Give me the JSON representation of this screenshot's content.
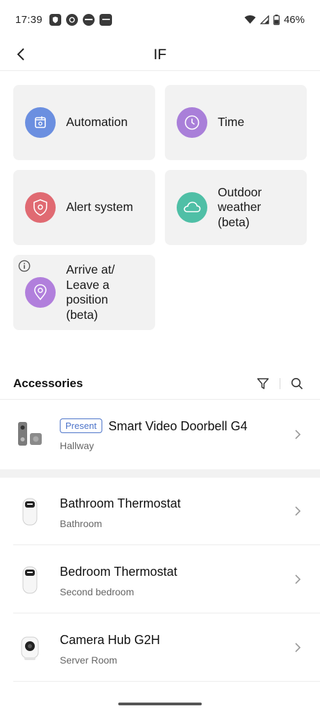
{
  "status_bar": {
    "time": "17:39",
    "notification_icons": [
      "shield-icon",
      "ring-icon",
      "yale-icon",
      "aqara-icon"
    ],
    "battery": "46%"
  },
  "header": {
    "title": "IF"
  },
  "tiles": [
    {
      "label": "Automation",
      "icon": "automation-icon",
      "color": "#6b8fe0"
    },
    {
      "label": "Time",
      "icon": "clock-icon",
      "color": "#a97fd9"
    },
    {
      "label": "Alert system",
      "icon": "shield-icon",
      "color": "#e06a72"
    },
    {
      "label": "Outdoor\nweather\n(beta)",
      "icon": "cloud-icon",
      "color": "#4fbfa6"
    },
    {
      "label": "Arrive at/\nLeave a\nposition\n(beta)",
      "icon": "location-pin-icon",
      "color": "#b17fdc"
    }
  ],
  "accessories": {
    "title": "Accessories",
    "items": [
      {
        "name": "Smart Video Doorbell G4",
        "room": "Hallway",
        "badge": "Present"
      },
      {
        "name": "Bathroom Thermostat",
        "room": "Bathroom"
      },
      {
        "name": "Bedroom Thermostat",
        "room": "Second bedroom"
      },
      {
        "name": "Camera Hub G2H",
        "room": "Server Room"
      }
    ]
  },
  "colors": {
    "accent": "#4a72c9",
    "tile_bg": "#f2f2f2"
  }
}
